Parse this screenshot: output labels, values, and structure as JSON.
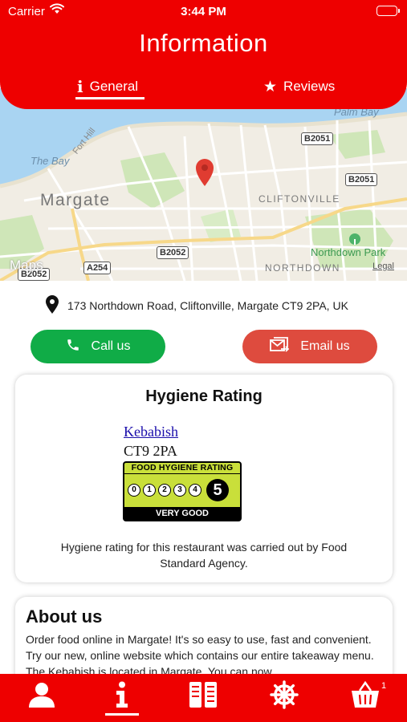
{
  "status_bar": {
    "carrier": "Carrier",
    "time": "3:44 PM"
  },
  "header": {
    "title": "Information",
    "tabs": [
      {
        "label": "General",
        "icon": "info-icon",
        "active": true
      },
      {
        "label": "Reviews",
        "icon": "star-icon",
        "active": false
      }
    ]
  },
  "map": {
    "labels": {
      "palm_bay": "Palm Bay",
      "fort_hill": "Fort Hill",
      "the_bay": "The Bay",
      "margate": "Margate",
      "cliftonville": "CLIFTONVILLE",
      "northdown_park": "Northdown Park",
      "northdown": "NORTHDOWN"
    },
    "roads": {
      "b2051_a": "B2051",
      "b2051_b": "B2051",
      "b2052_a": "B2052",
      "b2052_b": "B2052",
      "a254": "A254"
    },
    "provider": "Maps",
    "legal": "Legal",
    "colors": {
      "sea": "#a9d4f2",
      "land": "#f1ede4",
      "park": "#cfe6b8",
      "pin": "#e03c31"
    }
  },
  "address": {
    "text": "173 Northdown Road, Cliftonville, Margate CT9 2PA, UK",
    "icon": "map-pin-icon"
  },
  "actions": {
    "call_label": "Call us",
    "email_label": "Email us"
  },
  "hygiene": {
    "title": "Hygiene Rating",
    "business_name": "Kebabish",
    "postcode": "CT9 2PA",
    "badge_header": "FOOD HYGIENE RATING",
    "scale": [
      "0",
      "1",
      "2",
      "3",
      "4"
    ],
    "rating": "5",
    "rating_label": "VERY GOOD",
    "note": "Hygiene rating for this restaurant was carried out by Food Standard Agency."
  },
  "about": {
    "title": "About us",
    "text": "Order food online in Margate! It's so easy to use, fast and convenient. Try our new, online website which contains our entire takeaway menu. The Kebabish is located in Margate. You can now"
  },
  "bottom_nav": {
    "items": [
      {
        "icon": "user-icon",
        "active": false
      },
      {
        "icon": "info-icon",
        "active": true
      },
      {
        "icon": "menu-icon",
        "active": false
      },
      {
        "icon": "settings-icon",
        "active": false
      },
      {
        "icon": "basket-icon",
        "active": false
      }
    ],
    "cart_count": "1"
  },
  "colors": {
    "brand_red": "#ee0000",
    "call_green": "#10ac47",
    "email_red": "#de4b3e"
  }
}
